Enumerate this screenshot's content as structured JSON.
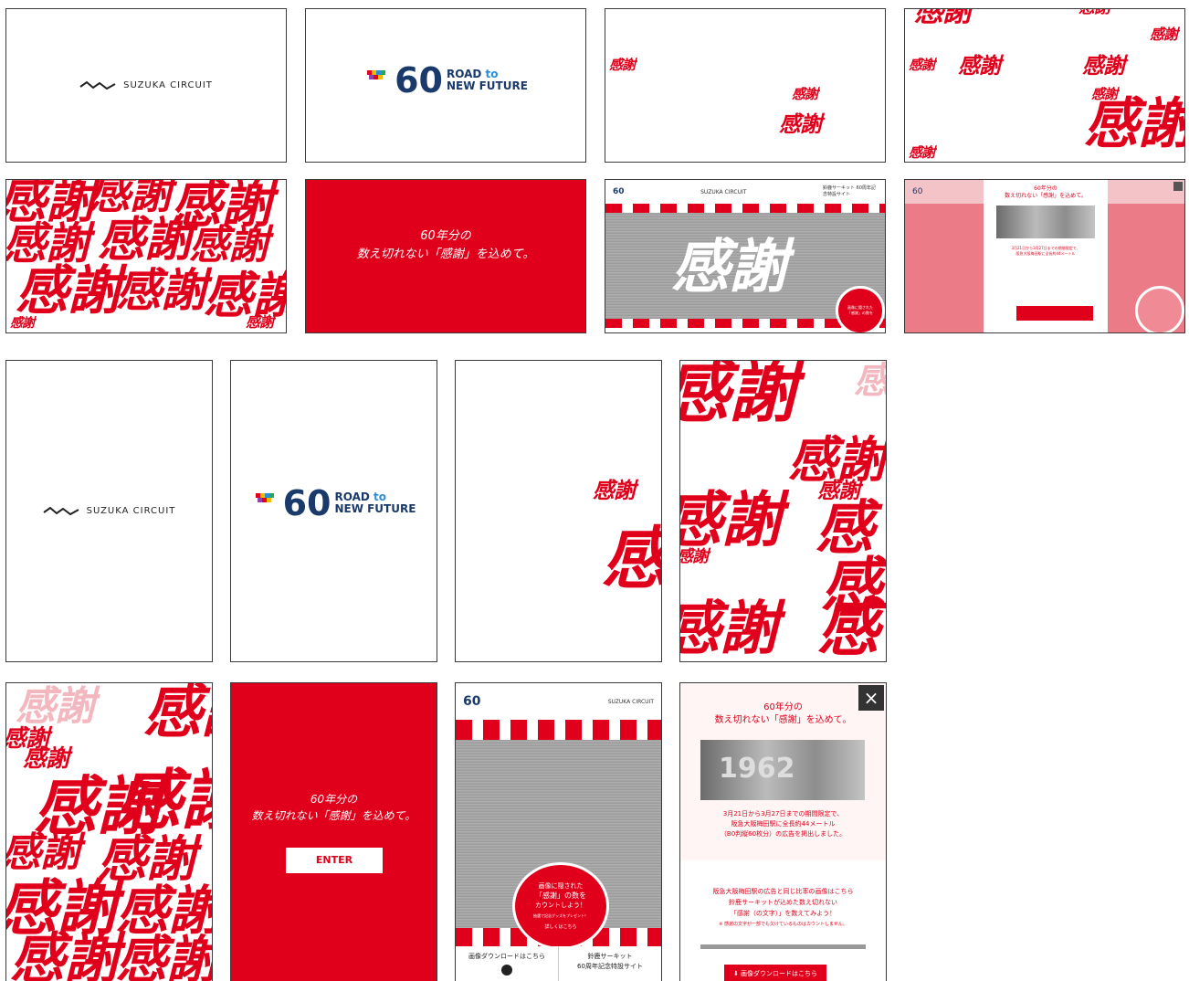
{
  "brand": {
    "suzuka_logo_text": "SUZUKA CIRCUIT",
    "logo60_line1": "ROAD",
    "logo60_to": "to",
    "logo60_line2": "NEW FUTURE",
    "logo60_number": "60"
  },
  "kanji": "感謝",
  "kanji_partial": "感",
  "tagline_line1": "60年分の",
  "tagline_line2": "数え切れない「感謝」を込めて。",
  "enter_button": "ENTER",
  "desktop_header": {
    "site_nav": "鈴鹿サーキット 60周年記念特設サイト"
  },
  "badge": {
    "line1": "画像に隠された",
    "line2": "「感謝」の数を",
    "line3": "カウントしよう！",
    "small": "抽選で記念グッズをプレゼント！",
    "btn": "詳しくはこちら"
  },
  "mobile_footer": {
    "download": "画像ダウンロードはこちら",
    "site_line1": "鈴鹿サーキット",
    "site_line2": "60周年記念特設サイト"
  },
  "modal": {
    "title1": "60年分の",
    "title2": "数え切れない「感謝」を込めて。",
    "desc1": "3月21日から3月27日までの期間限定で、",
    "desc2": "阪急大阪梅田駅に全長約44メートル",
    "desc3": "（B0判縦60枚分）の広告を掲出しました。",
    "info1": "阪急大阪梅田駅の広告と同じ比率の画像はこちら",
    "info2": "鈴鹿サーキットが込めた数え切れない",
    "info3": "「感謝（の文字）」を数えてみよう！",
    "note": "※ 感謝の文字が一部でも欠けているものはカウントしません。",
    "download_btn": "画像ダウンロードはこちら",
    "photo_year": "1962"
  },
  "colors": {
    "accent": "#e1001b",
    "navy": "#1a3a6b"
  }
}
